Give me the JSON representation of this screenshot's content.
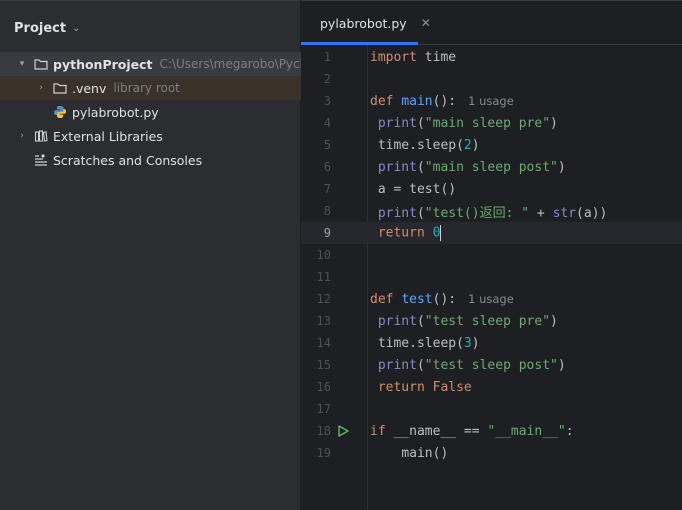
{
  "project_panel": {
    "title": "Project",
    "root": {
      "name": "pythonProject",
      "path": "C:\\Users\\megarobo\\Pycha"
    },
    "venv": {
      "name": ".venv",
      "hint": "library root"
    },
    "file": {
      "name": "pylabrobot.py"
    },
    "external": {
      "name": "External Libraries"
    },
    "scratches": {
      "name": "Scratches and Consoles"
    }
  },
  "editor": {
    "tab_title": "pylabrobot.py",
    "current_line": 9,
    "usage_hint": "1 usage",
    "line_numbers": [
      "1",
      "2",
      "3",
      "4",
      "5",
      "6",
      "7",
      "8",
      "9",
      "10",
      "11",
      "12",
      "13",
      "14",
      "15",
      "16",
      "17",
      "18",
      "19"
    ],
    "code": {
      "l1_kw": "import",
      "l1_rest": " time",
      "l3_kw": "def",
      "l3_fn": "main",
      "l3_rest": "():",
      "l4_fn": "print",
      "l4_str": "\"main sleep pre\"",
      "l5_a": "time.sleep(",
      "l5_num": "2",
      "l5_b": ")",
      "l6_fn": "print",
      "l6_str": "\"main sleep post\"",
      "l7": "a = test()",
      "l8_fn": "print",
      "l8_str": "\"test()返回: \"",
      "l8_mid": " + ",
      "l8_builtin": "str",
      "l8_end": "(a))",
      "l9_kw": "return",
      "l9_num": "0",
      "l12_kw": "def",
      "l12_fn": "test",
      "l12_rest": "():",
      "l13_fn": "print",
      "l13_str": "\"test sleep pre\"",
      "l14_a": "time.sleep(",
      "l14_num": "3",
      "l14_b": ")",
      "l15_fn": "print",
      "l15_str": "\"test sleep post\"",
      "l16_kw": "return",
      "l16_kw2": "False",
      "l18_kw": "if",
      "l18_mid": " __name__ == ",
      "l18_str": "\"__main__\"",
      "l18_end": ":",
      "l19": "main()"
    }
  },
  "colors": {
    "keyword": "#cf8e6d",
    "function": "#56a8f5",
    "string": "#6aab73",
    "number": "#2aacb8",
    "builtin": "#8888c6",
    "accent": "#3574f0"
  }
}
